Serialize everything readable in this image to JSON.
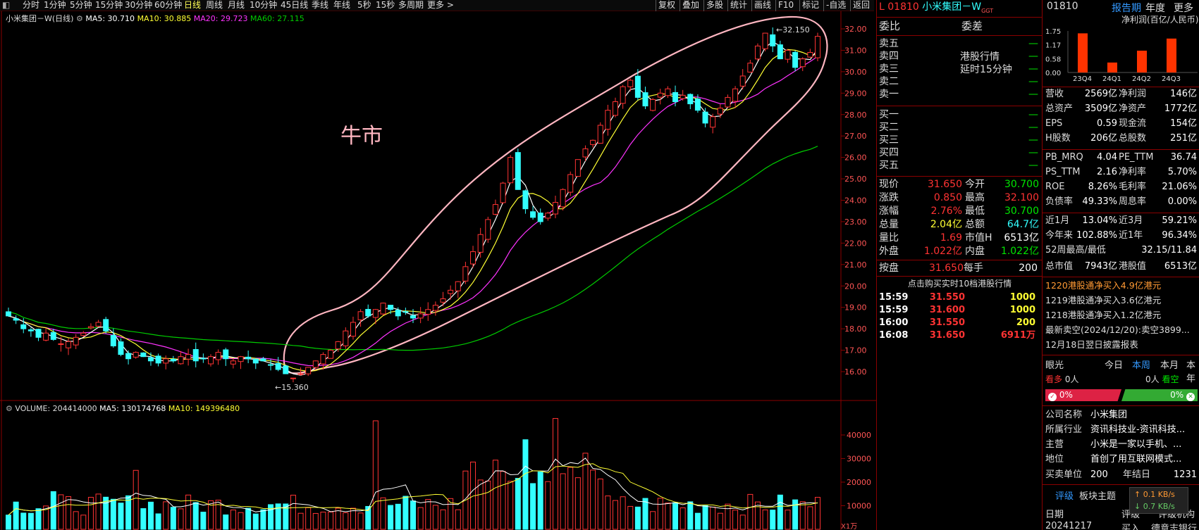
{
  "toolbar": {
    "timeframes": [
      "分时",
      "1分钟",
      "5分钟",
      "15分钟",
      "30分钟",
      "60分钟",
      "日线",
      "周线",
      "月线",
      "10分钟",
      "45日线",
      "季线",
      "年线",
      "5秒",
      "15秒",
      "多周期",
      "更多 >"
    ],
    "active": "日线",
    "right_buttons": [
      "复权",
      "叠加",
      "多股",
      "统计",
      "画线",
      "F10",
      "标记",
      "-自选",
      "返回"
    ]
  },
  "chart": {
    "legend_name": "小米集团－W(日线)",
    "ma5": "MA5: 30.710",
    "ma10": "MA10: 30.885",
    "ma20": "MA20: 29.723",
    "ma60": "MA60: 27.115",
    "annotation": "牛市",
    "high_label": "32.150",
    "low_label": "15.360",
    "price_ticks": [
      "32.00",
      "31.00",
      "30.00",
      "29.00",
      "28.00",
      "27.00",
      "26.00",
      "25.00",
      "24.00",
      "23.00",
      "22.00",
      "21.00",
      "20.00",
      "19.00",
      "18.00",
      "17.00",
      "16.00"
    ],
    "vol_legend": "VOLUME: 204414000",
    "vol_ma5": "MA5: 130174768",
    "vol_ma10": "MA10: 149396480",
    "vol_ticks": [
      "40000",
      "30000",
      "20000",
      "10000"
    ],
    "vol_unit": "X1万",
    "colors": {
      "up": "#ff3333",
      "down": "#33ffff",
      "ma5": "#ffffff",
      "ma10": "#ffff33",
      "ma20": "#ff33ff",
      "ma60": "#00cc00",
      "ellipse": "#ffb6c1"
    }
  },
  "chart_data": {
    "type": "candlestick",
    "x_range": [
      "",
      ""
    ],
    "ylim": [
      15.0,
      32.3
    ],
    "closes": [
      18.6,
      18.4,
      18.0,
      17.9,
      17.6,
      17.8,
      17.5,
      17.3,
      17.4,
      17.6,
      17.8,
      18.1,
      18.3,
      17.9,
      17.2,
      16.8,
      16.6,
      16.9,
      16.7,
      16.5,
      16.4,
      16.6,
      16.5,
      16.7,
      16.8,
      16.5,
      16.6,
      16.7,
      16.9,
      16.6,
      16.5,
      16.7,
      16.6,
      16.4,
      16.5,
      16.3,
      16.1,
      15.9,
      15.7,
      15.9,
      16.2,
      16.5,
      16.8,
      17.0,
      17.4,
      17.9,
      18.3,
      18.8,
      18.6,
      18.9,
      19.2,
      18.9,
      18.6,
      18.8,
      18.5,
      18.7,
      18.9,
      19.1,
      19.4,
      19.8,
      20.2,
      20.9,
      21.6,
      22.4,
      23.1,
      23.8,
      24.8,
      26.0,
      24.5,
      23.6,
      23.2,
      23.0,
      23.4,
      23.9,
      24.5,
      25.2,
      25.9,
      26.4,
      26.8,
      27.5,
      28.2,
      28.6,
      29.3,
      29.6,
      28.8,
      28.4,
      28.7,
      29.0,
      29.2,
      28.6,
      28.9,
      28.5,
      28.2,
      27.6,
      27.9,
      28.3,
      28.8,
      29.2,
      29.8,
      30.4,
      31.2,
      31.8,
      31.2,
      30.6,
      31.0,
      30.2,
      30.6,
      30.9,
      31.65
    ],
    "volume_ticks": [
      10000,
      20000,
      30000,
      40000
    ]
  },
  "quote": {
    "code": "L 01810",
    "name": "小米集团－W",
    "tag": "GGT",
    "weibi_label": "委比",
    "weicha_label": "委差",
    "sell_labels": [
      "卖五",
      "卖四",
      "卖三",
      "卖二",
      "卖一"
    ],
    "buy_labels": [
      "买一",
      "买二",
      "买三",
      "买四",
      "买五"
    ],
    "dash": "—",
    "hk_notice_1": "港股行情",
    "hk_notice_2": "延时15分钟",
    "stats": [
      {
        "l1": "现价",
        "v1": "31.650",
        "c1": "red",
        "l2": "今开",
        "v2": "30.700",
        "c2": "green"
      },
      {
        "l1": "涨跌",
        "v1": "0.850",
        "c1": "red",
        "l2": "最高",
        "v2": "32.100",
        "c2": "red"
      },
      {
        "l1": "涨幅",
        "v1": "2.76%",
        "c1": "red",
        "l2": "最低",
        "v2": "30.700",
        "c2": "green"
      },
      {
        "l1": "总量",
        "v1": "2.04亿",
        "c1": "yellow",
        "l2": "总额",
        "v2": "64.7亿",
        "c2": "cyan"
      },
      {
        "l1": "量比",
        "v1": "1.69",
        "c1": "red",
        "l2": "市值H",
        "v2": "6513亿",
        "c2": "white"
      },
      {
        "l1": "外盘",
        "v1": "1.022亿",
        "c1": "red",
        "l2": "内盘",
        "v2": "1.022亿",
        "c2": "green"
      }
    ],
    "anpan_label": "按盘",
    "anpan_value": "31.650",
    "meishou_label": "每手",
    "meishou_value": "200",
    "click_notice": "点击购买实时10档港股行情",
    "ticks": [
      {
        "time": "15:59",
        "price": "31.550",
        "vol": "1000",
        "vc": "yellow"
      },
      {
        "time": "15:59",
        "price": "31.600",
        "vol": "1000",
        "vc": "yellow"
      },
      {
        "time": "16:00",
        "price": "31.550",
        "vol": "200",
        "vc": "yellow"
      },
      {
        "time": "16:08",
        "price": "31.650",
        "vol": "6911万",
        "vc": "red"
      }
    ]
  },
  "fund": {
    "code": "01810",
    "tab_report": "报告期",
    "tab_year": "年度",
    "tab_more": "更多",
    "bar_title": "净利润(百亿/人民币)",
    "bar_ticks": [
      "1.75",
      "1.17",
      "0.58",
      "0.00"
    ],
    "bar_data": {
      "categories": [
        "23Q4",
        "24Q1",
        "24Q2",
        "24Q3"
      ],
      "values": [
        1.65,
        0.42,
        0.92,
        1.43
      ],
      "ylim": [
        0,
        1.75
      ]
    },
    "fin": [
      {
        "l1": "营收",
        "v1": "2569亿",
        "l2": "净利润",
        "v2": "146亿"
      },
      {
        "l1": "总资产",
        "v1": "3509亿",
        "l2": "净资产",
        "v2": "1772亿"
      },
      {
        "l1": "EPS",
        "v1": "0.59",
        "l2": "现金流",
        "v2": "154亿"
      },
      {
        "l1": "H股数",
        "v1": "206亿",
        "l2": "总股数",
        "v2": "251亿"
      }
    ],
    "ratios": [
      {
        "l1": "PB_MRQ",
        "v1": "4.04",
        "l2": "PE_TTM",
        "v2": "36.74"
      },
      {
        "l1": "PS_TTM",
        "v1": "2.16",
        "l2": "净利率",
        "v2": "5.70%"
      },
      {
        "l1": "ROE",
        "v1": "8.26%",
        "l2": "毛利率",
        "v2": "21.06%"
      },
      {
        "l1": "负债率",
        "v1": "49.33%",
        "l2": "周息率",
        "v2": "0.00%"
      }
    ],
    "perf": [
      {
        "l1": "近1月",
        "v1": "13.04%",
        "l2": "近3月",
        "v2": "59.21%"
      },
      {
        "l1": "今年来",
        "v1": "102.88%",
        "l2": "近1年",
        "v2": "96.34%"
      }
    ],
    "week52_label": "52周最高/最低",
    "week52_value": "32.15/11.84",
    "mktcap_label": "总市值",
    "mktcap_value": "7943亿",
    "hkcap_label": "港股值",
    "hkcap_value": "6513亿",
    "news": [
      {
        "text": "1220港股通净买入4.9亿港元",
        "color": "#ff9933"
      },
      {
        "text": "1219港股通净买入3.6亿港元",
        "color": "#dddddd"
      },
      {
        "text": "1218港股通净买入1.2亿港元",
        "color": "#dddddd"
      },
      {
        "text": "最新卖空(2024/12/20):卖空3899...",
        "color": "#dddddd"
      },
      {
        "text": "12月18日翌日披露报表",
        "color": "#dddddd"
      }
    ],
    "yanguang": "眼光",
    "period_tabs": [
      "今日",
      "本周",
      "本月",
      "本年"
    ],
    "kanduo": "看多",
    "kanduo_count": "0人",
    "kankong": "看空",
    "kankong_count": "0人",
    "bull_pct": "0%",
    "bear_pct": "0%",
    "company": [
      {
        "l": "公司名称",
        "v": "小米集团"
      },
      {
        "l": "所属行业",
        "v": "资讯科技业-资讯科技..."
      },
      {
        "l": "主营",
        "v": "小米是一家以手机、..."
      },
      {
        "l": "地位",
        "v": "首创了用互联网模式..."
      }
    ],
    "unit_label": "买卖单位",
    "unit_value": "200",
    "year_end_label": "年结日",
    "year_end_value": "1231",
    "rating_tab": "评级",
    "theme_tab": "板块主题",
    "rating_col": "评级",
    "org_col": "评级机构",
    "date_label": "日期",
    "rating_date": "20241217",
    "rating_value": "买入",
    "rating_org": "德意志银行",
    "net_up": "↑ 0.1 KB/s",
    "net_down": "↓ 0.7 KB/s"
  }
}
